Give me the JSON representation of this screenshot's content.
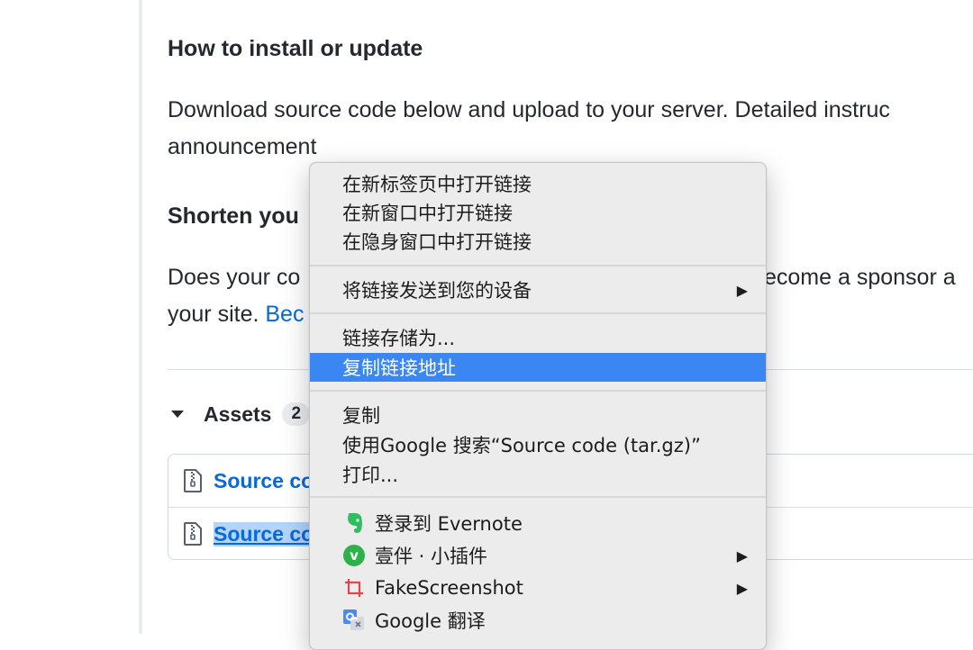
{
  "page": {
    "install_heading": "How to install or update",
    "install_text_line1": "Download source code below and upload to your server. Detailed instruc",
    "install_text_line2": "announcement",
    "shorten_heading_partial": "Shorten you",
    "does_line_left": "Does your co",
    "does_line_right": "ecome a sponsor a",
    "your_site_text": "your site. ",
    "become_link_partial": "Bec"
  },
  "assets": {
    "label": "Assets",
    "count": "2",
    "items": [
      {
        "label": "Source co"
      },
      {
        "label": "Source co"
      }
    ]
  },
  "context_menu": {
    "items": {
      "open_new_tab": "在新标签页中打开链接",
      "open_new_window": "在新窗口中打开链接",
      "open_incognito": "在隐身窗口中打开链接",
      "send_to_devices": "将链接发送到您的设备",
      "save_link_as": "链接存储为...",
      "copy_link_address": "复制链接地址",
      "copy": "复制",
      "search_google": "使用Google 搜索“Source code (tar.gz)”",
      "print": "打印...",
      "evernote": "登录到 Evernote",
      "yiban": "壹伴 · 小插件",
      "fakescreenshot": "FakeScreenshot",
      "google_translate": "Google 翻译"
    },
    "submenu_arrow": "▶",
    "yiban_glyph": "v"
  },
  "colors": {
    "link": "#0969da",
    "menu_highlight": "#3a86f3",
    "evernote_green": "#2dbe60",
    "yiban_green": "#2fb14a",
    "fakescreenshot_red": "#e0454a",
    "google_translate_blue": "#4a8af4"
  },
  "icons": {
    "asset": "zip-file-icon",
    "evernote": "evernote-elephant-icon",
    "yiban": "yiban-v-icon",
    "fakescreenshot": "crop-icon",
    "google_translate": "google-translate-icon"
  }
}
